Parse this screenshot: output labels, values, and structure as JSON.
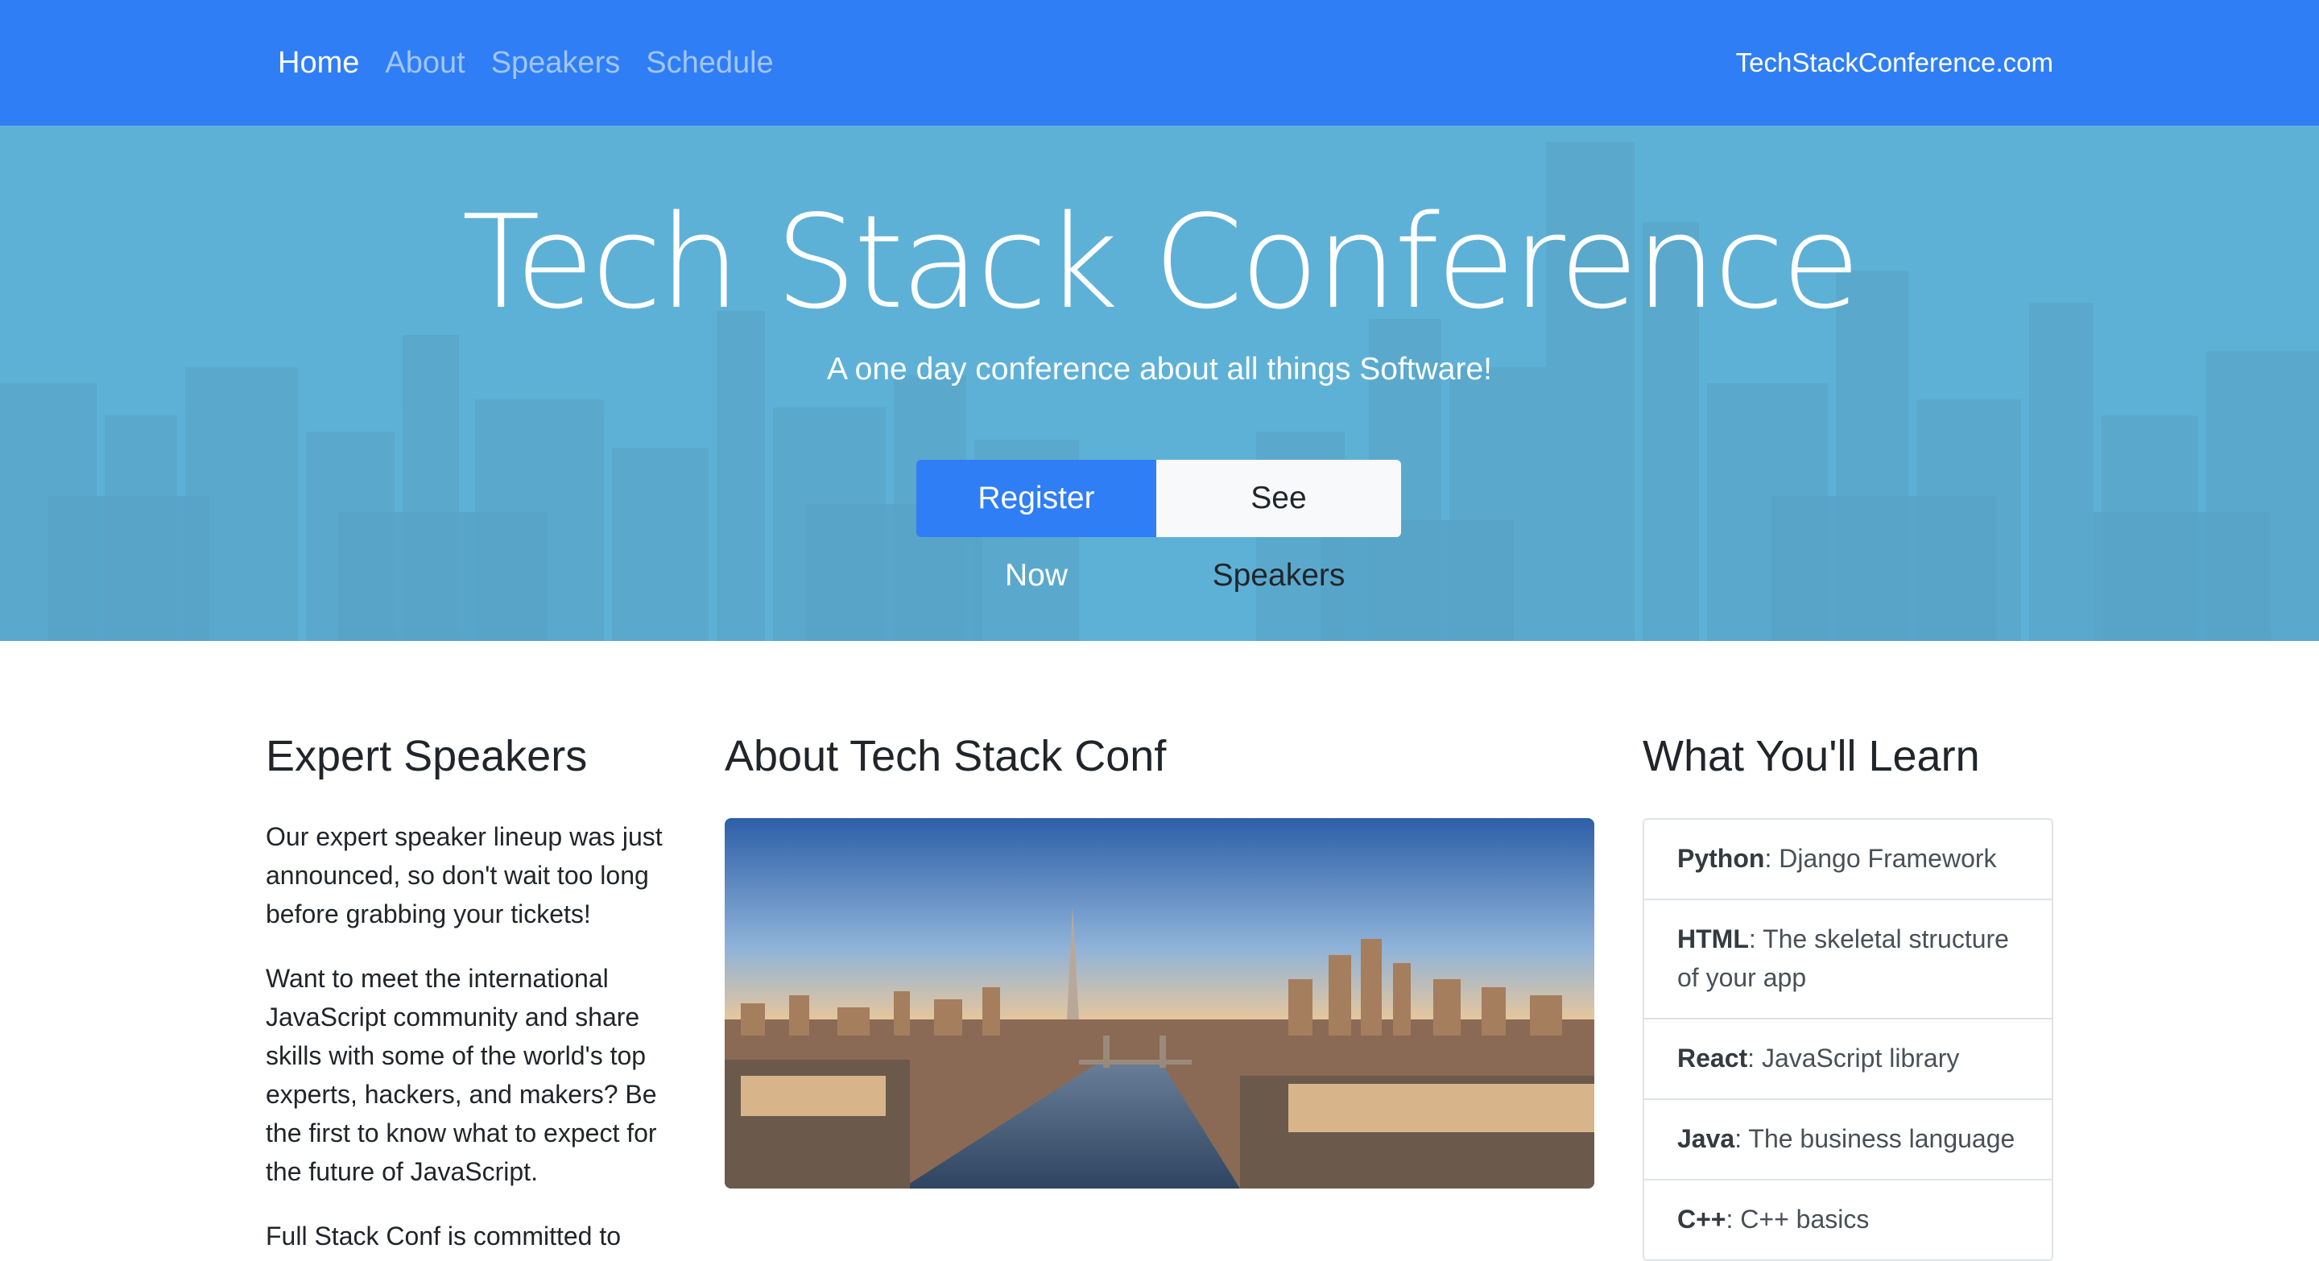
{
  "nav": {
    "links": [
      {
        "label": "Home",
        "active": true
      },
      {
        "label": "About",
        "active": false
      },
      {
        "label": "Speakers",
        "active": false
      },
      {
        "label": "Schedule",
        "active": false
      }
    ],
    "brand": "TechStackConference.com"
  },
  "hero": {
    "title": "Tech Stack Conference",
    "subtitle": "A one day conference about all things Software!",
    "register_label": "Register Now",
    "speakers_label": "See Speakers"
  },
  "speakers": {
    "heading": "Expert Speakers",
    "paragraphs": [
      "Our expert speaker lineup was just announced, so don't wait too long before grabbing your tickets!",
      "Want to meet the international JavaScript community and share skills with some of the world's top experts, hackers, and makers? Be the first to know what to expect for the future of JavaScript.",
      "Full Stack Conf is committed to"
    ]
  },
  "about": {
    "heading": "About Tech Stack Conf"
  },
  "learn": {
    "heading": "What You'll Learn",
    "items": [
      {
        "term": "Python",
        "desc": ": Django Framework"
      },
      {
        "term": "HTML",
        "desc": ": The skeletal structure of your app"
      },
      {
        "term": "React",
        "desc": ": JavaScript library"
      },
      {
        "term": "Java",
        "desc": ": The business language"
      },
      {
        "term": "C++",
        "desc": ": C++ basics"
      }
    ]
  },
  "colors": {
    "navbar": "#2f7ef6",
    "hero": "#5eb1d6",
    "primary": "#2f7ef6"
  }
}
